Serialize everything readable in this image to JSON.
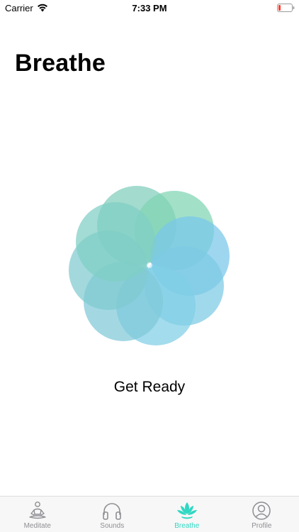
{
  "status_bar": {
    "carrier": "Carrier",
    "time": "7:33 PM"
  },
  "page": {
    "title": "Breathe",
    "status": "Get Ready"
  },
  "tabs": [
    {
      "label": "Meditate",
      "icon": "meditate-icon",
      "active": false
    },
    {
      "label": "Sounds",
      "icon": "headphones-icon",
      "active": false
    },
    {
      "label": "Breathe",
      "icon": "lotus-icon",
      "active": true
    },
    {
      "label": "Profile",
      "icon": "profile-icon",
      "active": false
    }
  ],
  "colors": {
    "accent": "#2ed8c3",
    "inactive": "#8e8e93",
    "petal_green": "#7fd3b5",
    "petal_blue": "#7fcbe6",
    "battery_low": "#ff3b30"
  }
}
